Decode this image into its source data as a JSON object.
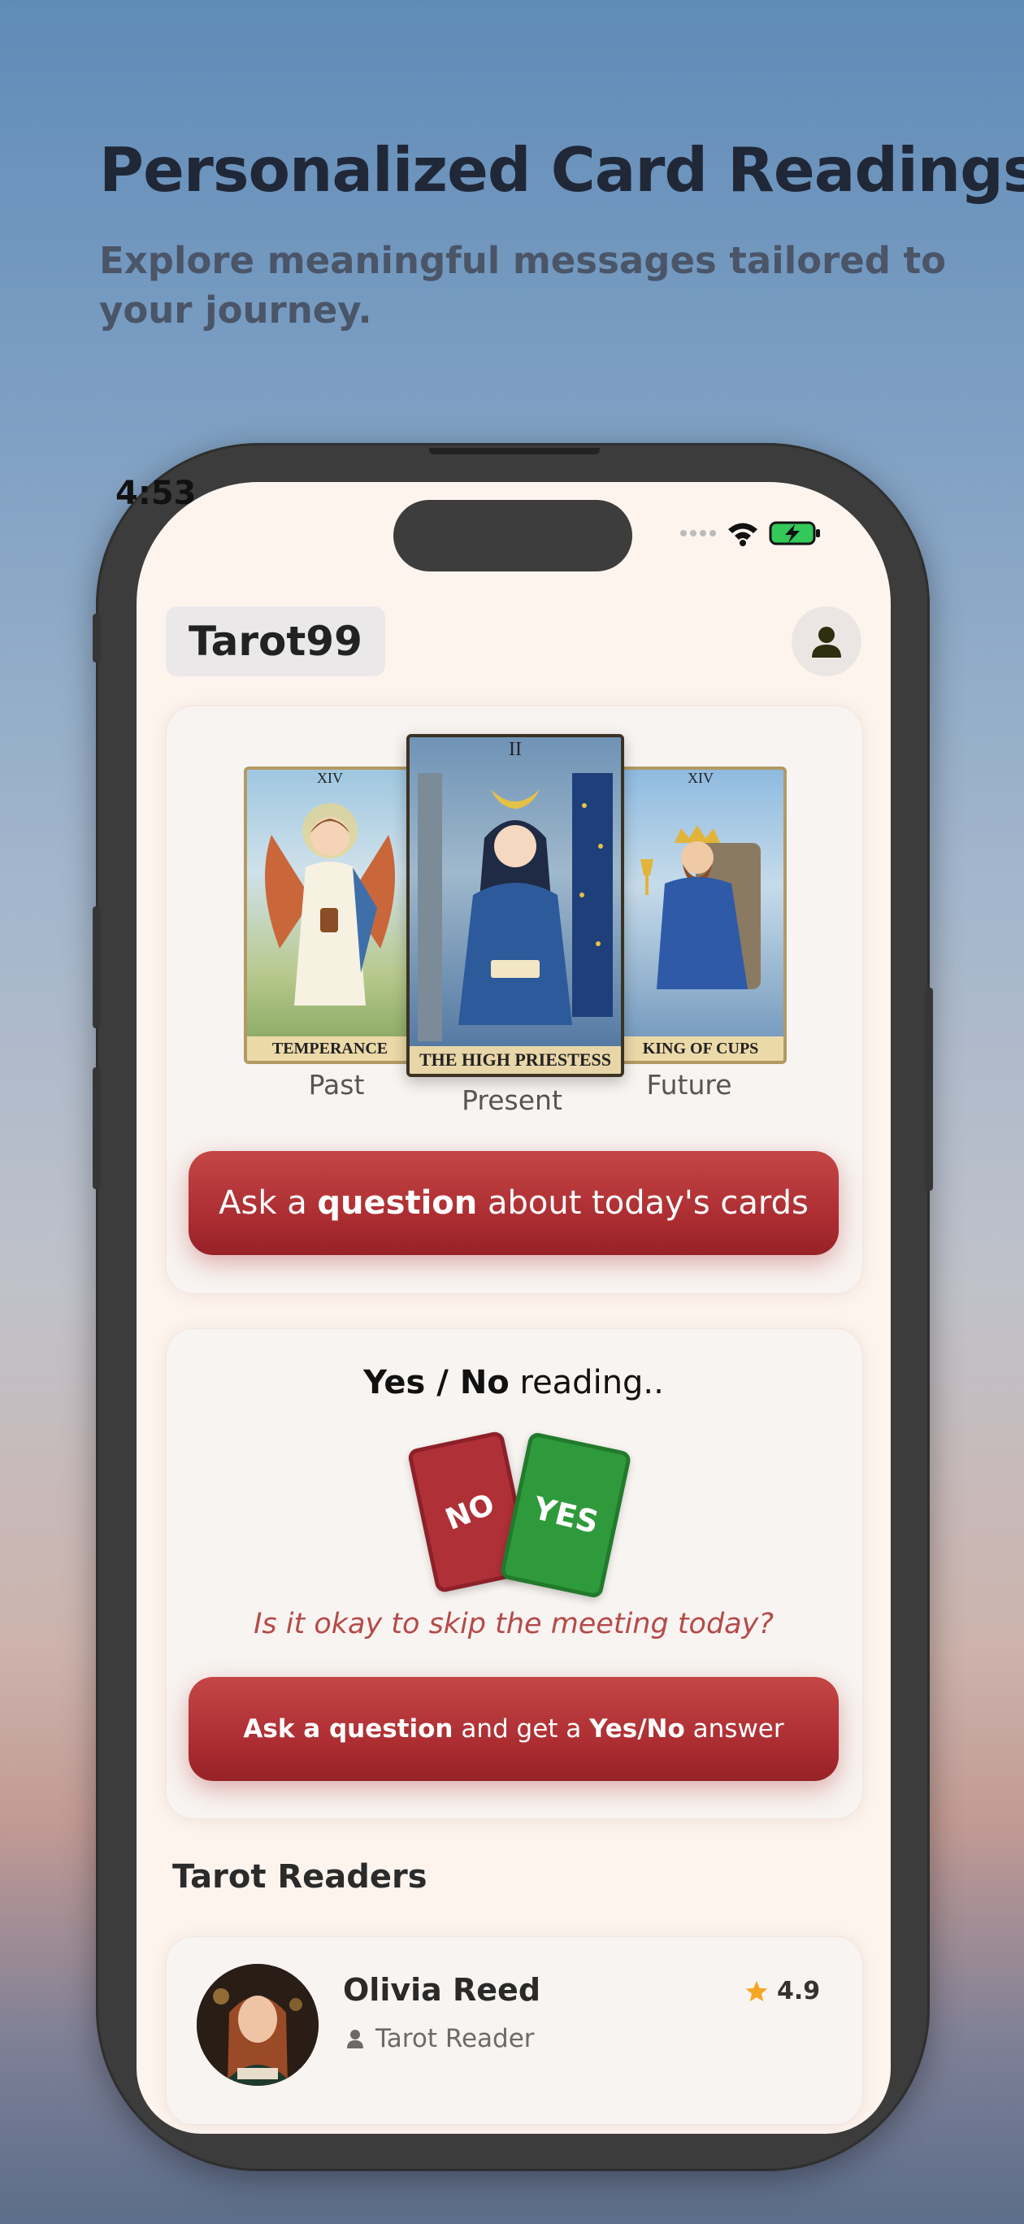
{
  "promo": {
    "title": "Personalized Card Readings",
    "subtitle": "Explore meaningful messages tailored to your journey."
  },
  "status_bar": {
    "time": "4:53",
    "icons": [
      "signal-dots-icon",
      "wifi-icon",
      "battery-charging-icon"
    ]
  },
  "header": {
    "logo": "Tarot99",
    "profile_icon": "person-icon"
  },
  "daily_spread": {
    "cards": [
      {
        "numeral": "XIV",
        "name": "TEMPERANCE",
        "position": "Past"
      },
      {
        "numeral": "II",
        "name": "THE HIGH PRIESTESS",
        "position": "Present"
      },
      {
        "numeral": "XIV",
        "name": "KING OF CUPS",
        "position": "Future"
      }
    ],
    "button": {
      "prefix": "Ask a ",
      "bold": "question",
      "suffix": " about today's cards"
    }
  },
  "yes_no": {
    "title_bold": "Yes / No",
    "title_rest": " reading..",
    "card_no": "NO",
    "card_yes": "YES",
    "question": "Is it okay to skip the meeting today?",
    "button": {
      "bold1": "Ask a question",
      "mid": " and get a ",
      "bold2": "Yes/No",
      "suffix": " answer"
    }
  },
  "readers": {
    "section_title": "Tarot Readers",
    "items": [
      {
        "name": "Olivia Reed",
        "role": "Tarot Reader",
        "rating": "4.9"
      }
    ]
  },
  "colors": {
    "accent_red": "#a92b30",
    "yes_green": "#2f9a3c",
    "no_red": "#b03038",
    "star": "#f5a623"
  }
}
